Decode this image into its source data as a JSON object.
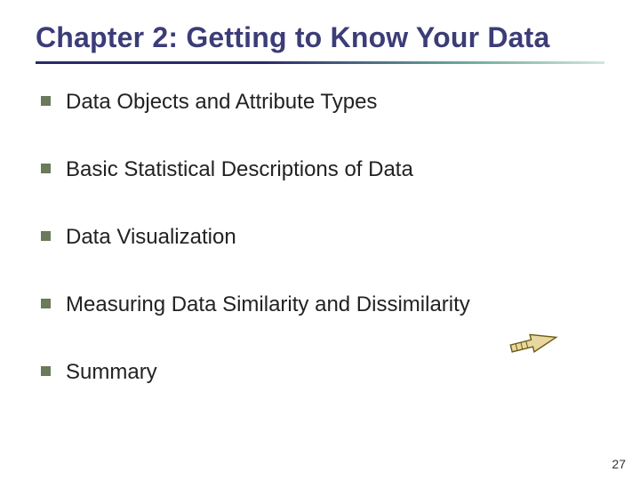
{
  "title": "Chapter 2: Getting to Know Your Data",
  "bullets": {
    "b0": "Data Objects and Attribute Types",
    "b1": "Basic Statistical Descriptions of Data",
    "b2": "Data Visualization",
    "b3": "Measuring Data Similarity and Dissimilarity",
    "b4": "Summary"
  },
  "page_number": "27"
}
